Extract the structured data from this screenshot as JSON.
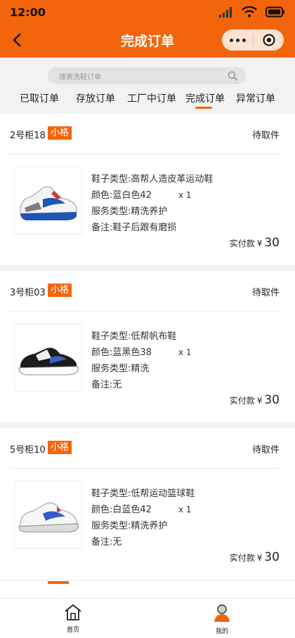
{
  "status_bar": {
    "time": "12:00"
  },
  "header": {
    "title": "完成订单"
  },
  "search": {
    "placeholder": "搜索洗鞋订单"
  },
  "tabs": [
    {
      "label": "已取订单",
      "active": false
    },
    {
      "label": "存放订单",
      "active": false
    },
    {
      "label": "工厂中订单",
      "active": false
    },
    {
      "label": "完成订单",
      "active": true
    },
    {
      "label": "异常订单",
      "active": false
    }
  ],
  "orders": [
    {
      "cabinet": "2号柜18",
      "size": "小格",
      "status": "待取件",
      "shoe_type": "鞋子类型:高帮人造皮革运动鞋",
      "color": "颜色:蓝白色42",
      "quantity": "x 1",
      "service": "服务类型:精洗养护",
      "note": "备注:鞋子后跟有磨损",
      "paid_label": "实付款",
      "currency": "¥",
      "amount": "30"
    },
    {
      "cabinet": "3号柜03",
      "size": "小格",
      "status": "待取件",
      "shoe_type": "鞋子类型:低帮帆布鞋",
      "color": "颜色:蓝黑色38",
      "quantity": "x 1",
      "service": "服务类型:精洗",
      "note": "备注:无",
      "paid_label": "实付款",
      "currency": "¥",
      "amount": "30"
    },
    {
      "cabinet": "5号柜10",
      "size": "小格",
      "status": "待取件",
      "shoe_type": "鞋子类型:低帮运动篮球鞋",
      "color": "颜色:白蓝色42",
      "quantity": "x 1",
      "service": "服务类型:精洗养护",
      "note": "备注:无",
      "paid_label": "实付款",
      "currency": "¥",
      "amount": "30"
    }
  ],
  "bottom_nav": [
    {
      "label": "首页",
      "icon": "home-icon"
    },
    {
      "label": "我的",
      "icon": "user-icon"
    }
  ],
  "colors": {
    "accent": "#f3650b",
    "capsule": "#fbe3d3"
  }
}
